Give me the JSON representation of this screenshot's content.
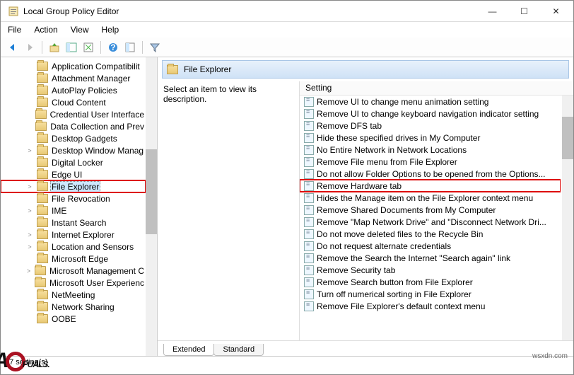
{
  "window": {
    "title": "Local Group Policy Editor",
    "min": "—",
    "max": "☐",
    "close": "✕"
  },
  "menubar": [
    "File",
    "Action",
    "View",
    "Help"
  ],
  "tree_items": [
    {
      "label": "Application Compatibilit",
      "exp": ""
    },
    {
      "label": "Attachment Manager",
      "exp": ""
    },
    {
      "label": "AutoPlay Policies",
      "exp": ""
    },
    {
      "label": "Cloud Content",
      "exp": ""
    },
    {
      "label": "Credential User Interface",
      "exp": ""
    },
    {
      "label": "Data Collection and Prev",
      "exp": ""
    },
    {
      "label": "Desktop Gadgets",
      "exp": ""
    },
    {
      "label": "Desktop Window Manag",
      "exp": ">"
    },
    {
      "label": "Digital Locker",
      "exp": ""
    },
    {
      "label": "Edge UI",
      "exp": ""
    },
    {
      "label": "File Explorer",
      "exp": ">",
      "selected": true,
      "hilite": true
    },
    {
      "label": "File Revocation",
      "exp": ""
    },
    {
      "label": "IME",
      "exp": ">"
    },
    {
      "label": "Instant Search",
      "exp": ""
    },
    {
      "label": "Internet Explorer",
      "exp": ">"
    },
    {
      "label": "Location and Sensors",
      "exp": ">"
    },
    {
      "label": "Microsoft Edge",
      "exp": ""
    },
    {
      "label": "Microsoft Management C",
      "exp": ">"
    },
    {
      "label": "Microsoft User Experienc",
      "exp": ""
    },
    {
      "label": "NetMeeting",
      "exp": ""
    },
    {
      "label": "Network Sharing",
      "exp": ""
    },
    {
      "label": "OOBE",
      "exp": ""
    }
  ],
  "header": {
    "title": "File Explorer"
  },
  "description": "Select an item to view its description.",
  "list_header": "Setting",
  "settings": [
    {
      "label": "Remove UI to change menu animation setting"
    },
    {
      "label": "Remove UI to change keyboard navigation indicator setting"
    },
    {
      "label": "Remove DFS tab"
    },
    {
      "label": "Hide these specified drives in My Computer"
    },
    {
      "label": "No Entire Network in Network Locations"
    },
    {
      "label": "Remove File menu from File Explorer"
    },
    {
      "label": "Do not allow Folder Options to be opened from the Options..."
    },
    {
      "label": "Remove Hardware tab",
      "hilite": true
    },
    {
      "label": "Hides the Manage item on the File Explorer context menu"
    },
    {
      "label": "Remove Shared Documents from My Computer"
    },
    {
      "label": "Remove \"Map Network Drive\" and \"Disconnect Network Dri..."
    },
    {
      "label": "Do not move deleted files to the Recycle Bin"
    },
    {
      "label": "Do not request alternate credentials"
    },
    {
      "label": "Remove the Search the Internet \"Search again\" link"
    },
    {
      "label": "Remove Security tab"
    },
    {
      "label": "Remove Search button from File Explorer"
    },
    {
      "label": "Turn off numerical sorting in File Explorer"
    },
    {
      "label": "Remove File Explorer's default context menu"
    }
  ],
  "tabs": {
    "extended": "Extended",
    "standard": "Standard"
  },
  "statusbar": "47 setting(s)",
  "watermark": "wsxdn.com",
  "brand": "PUALS."
}
